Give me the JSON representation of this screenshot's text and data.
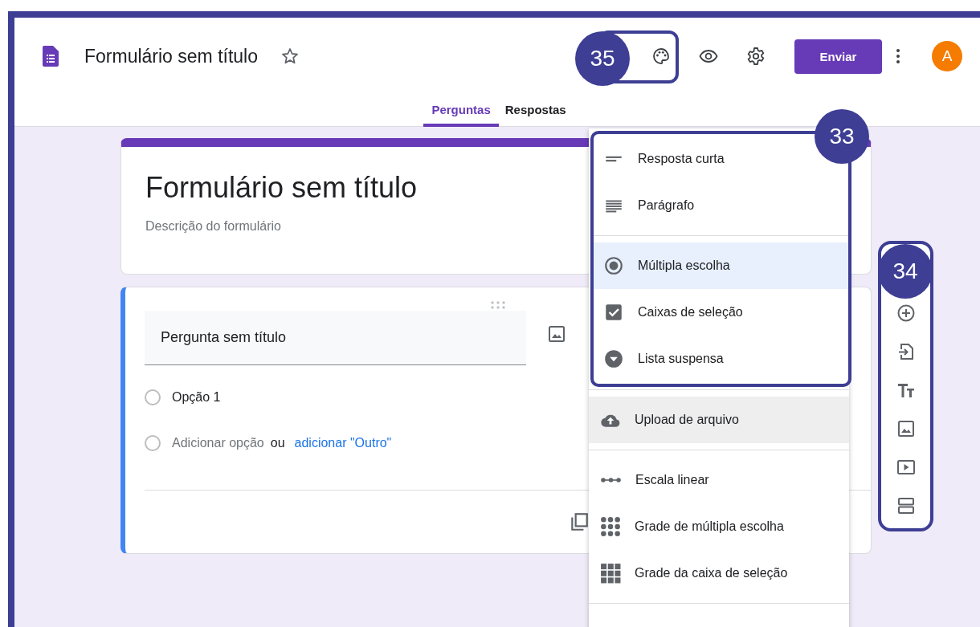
{
  "header": {
    "title": "Formulário sem título",
    "send_button": "Enviar",
    "avatar": "A",
    "callout": "35"
  },
  "tabs": [
    {
      "label": "Perguntas",
      "selected": true
    },
    {
      "label": "Respostas",
      "selected": false
    }
  ],
  "form": {
    "title": "Formulário sem título",
    "description_placeholder": "Descrição do formulário"
  },
  "question": {
    "title": "Pergunta sem título",
    "options": [
      {
        "label": "Opção 1",
        "checked": false
      }
    ],
    "add_option": "Adicionar opção",
    "add_option_checked": false,
    "or": "ou",
    "add_other": "adicionar \"Outro\""
  },
  "menu": {
    "callout": "33",
    "groups": [
      [
        {
          "kind": "short",
          "label": "Resposta curta",
          "selected": false,
          "hovered": false
        },
        {
          "kind": "paragraph",
          "label": "Parágrafo",
          "selected": false,
          "hovered": false
        }
      ],
      [
        {
          "kind": "radio",
          "label": "Múltipla escolha",
          "selected": true,
          "hovered": false
        },
        {
          "kind": "checkbox",
          "label": "Caixas de seleção",
          "selected": false,
          "hovered": false
        },
        {
          "kind": "dropdown",
          "label": "Lista suspensa",
          "selected": false,
          "hovered": false
        }
      ],
      [
        {
          "kind": "upload",
          "label": "Upload de arquivo",
          "selected": false,
          "hovered": true
        }
      ],
      [
        {
          "kind": "scale",
          "label": "Escala linear",
          "selected": false,
          "hovered": false
        },
        {
          "kind": "grid-radio",
          "label": "Grade de múltipla escolha",
          "selected": false,
          "hovered": false
        },
        {
          "kind": "grid-check",
          "label": "Grade da caixa de seleção",
          "selected": false,
          "hovered": false
        }
      ]
    ]
  },
  "toolbar": {
    "callout": "34"
  }
}
